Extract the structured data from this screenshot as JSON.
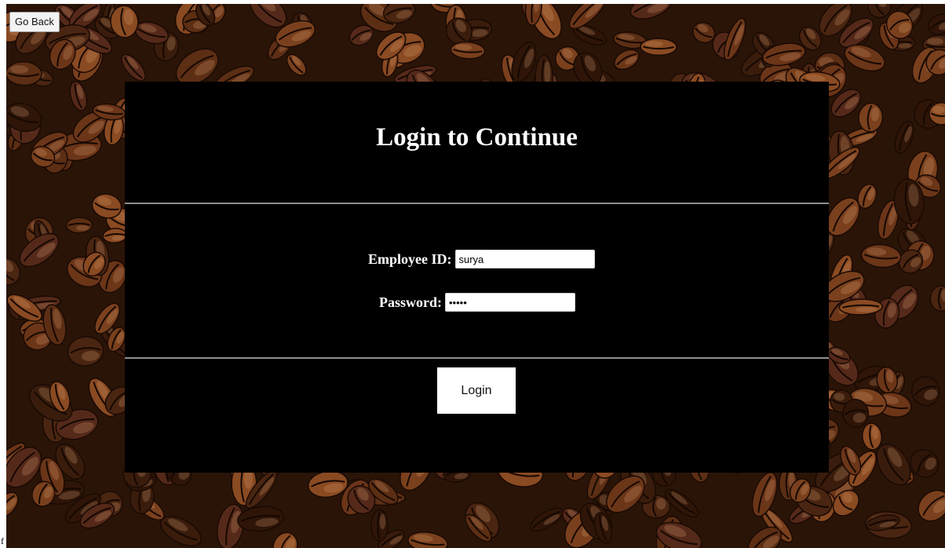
{
  "nav": {
    "go_back_label": "Go Back"
  },
  "edge_text": "f",
  "login": {
    "title": "Login to Continue",
    "employee_id_label": "Employee ID:",
    "employee_id_value": "surya",
    "password_label": "Password:",
    "password_value": "•••••",
    "login_label": "Login"
  },
  "colors": {
    "panel_bg": "#000000",
    "divider": "#8f8f8f",
    "background": "#2a1408"
  },
  "background_image": "coffee-beans"
}
